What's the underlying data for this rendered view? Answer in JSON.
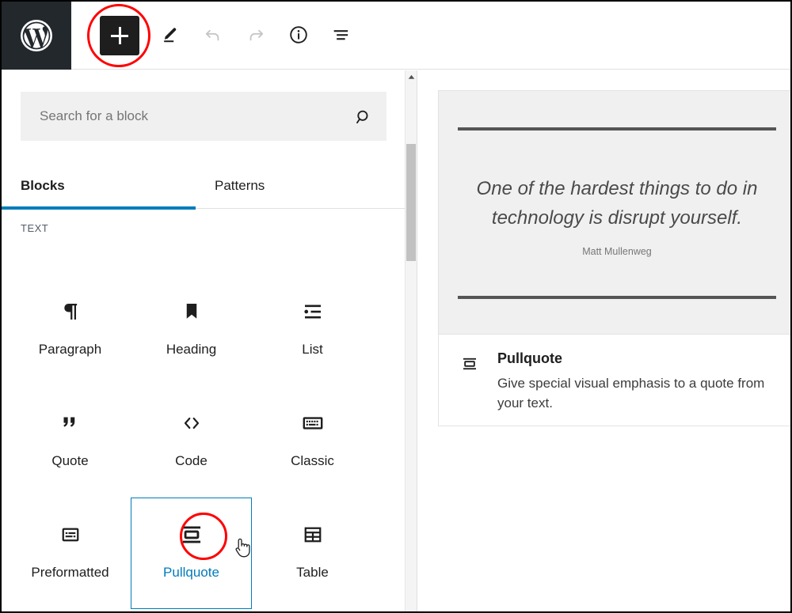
{
  "topbar": {
    "logo_icon": "wordpress-logo-icon",
    "inserter": {
      "label": "+",
      "icon": "plus-icon",
      "aria_label": "Toggle block inserter",
      "highlighted": true
    },
    "tools": [
      {
        "name": "edit",
        "icon": "pencil-icon",
        "label": "Edit",
        "disabled": false
      },
      {
        "name": "undo",
        "icon": "undo-arrow-icon",
        "label": "Undo",
        "disabled": true
      },
      {
        "name": "redo",
        "icon": "redo-arrow-icon",
        "label": "Redo",
        "disabled": true
      },
      {
        "name": "details",
        "icon": "info-circle-icon",
        "label": "Details",
        "disabled": false
      },
      {
        "name": "list-view",
        "icon": "list-view-icon",
        "label": "List View",
        "disabled": false
      }
    ]
  },
  "inserter_panel": {
    "search": {
      "placeholder": "Search for a block",
      "value": "",
      "icon": "search-icon"
    },
    "tabs": [
      {
        "label": "Blocks",
        "active": true
      },
      {
        "label": "Patterns",
        "active": false
      }
    ],
    "category_label": "TEXT",
    "blocks": [
      {
        "label": "Paragraph",
        "icon": "paragraph-pilcrow-icon",
        "selected": false
      },
      {
        "label": "Heading",
        "icon": "heading-bookmark-icon",
        "selected": false
      },
      {
        "label": "List",
        "icon": "list-icon",
        "selected": false
      },
      {
        "label": "Quote",
        "icon": "quote-marks-icon",
        "selected": false
      },
      {
        "label": "Code",
        "icon": "code-angle-brackets-icon",
        "selected": false
      },
      {
        "label": "Classic",
        "icon": "classic-keyboard-icon",
        "selected": false
      },
      {
        "label": "Preformatted",
        "icon": "preformatted-icon",
        "selected": false
      },
      {
        "label": "Pullquote",
        "icon": "pullquote-icon",
        "selected": true
      },
      {
        "label": "Table",
        "icon": "table-grid-icon",
        "selected": false
      }
    ],
    "scrollbar": {
      "up_arrow_icon": "chevron-up-icon"
    }
  },
  "preview_panel": {
    "quote": {
      "text": "One of the hardest things to do in technology is disrupt yourself.",
      "citation": "Matt Mullenweg"
    },
    "description": {
      "icon": "pullquote-icon",
      "title": "Pullquote",
      "body": "Give special visual emphasis to a quote from your text."
    }
  },
  "colors": {
    "accent_blue": "#007cba",
    "annotation_red": "#ff0000",
    "admin_dark": "#23282d",
    "panel_gray": "#f0f0f0"
  }
}
